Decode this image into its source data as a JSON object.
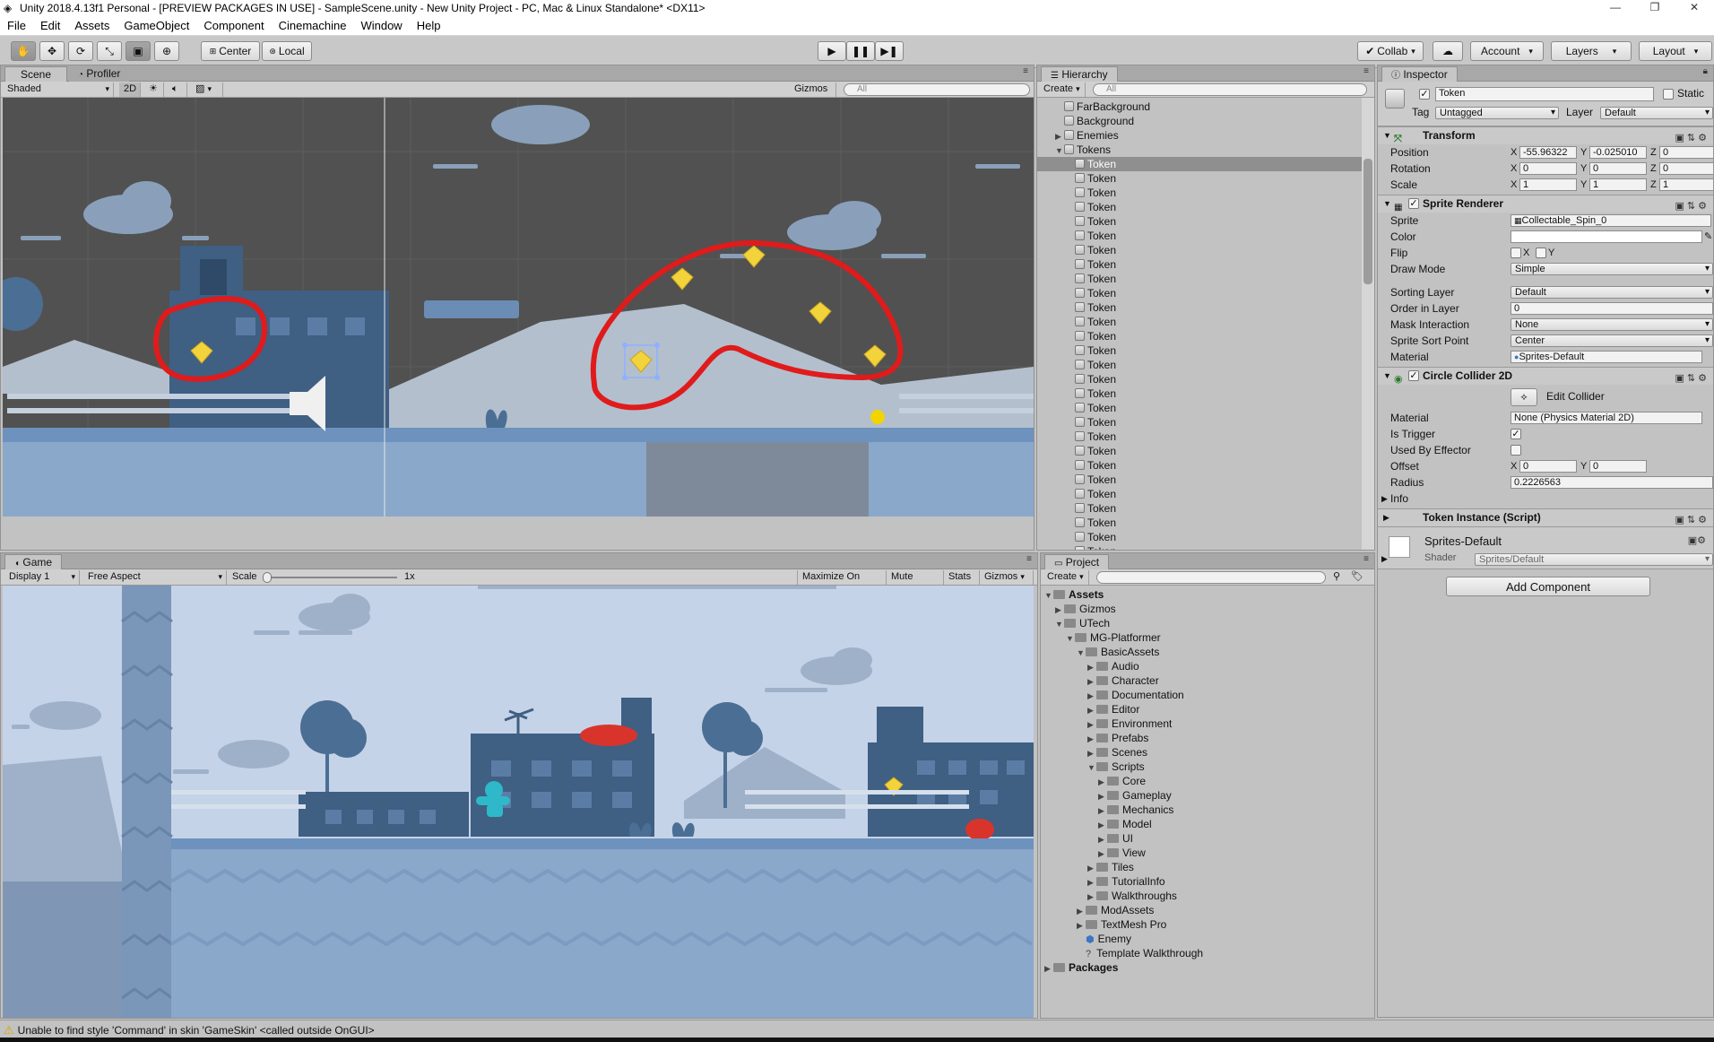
{
  "window": {
    "title": "Unity 2018.4.13f1 Personal - [PREVIEW PACKAGES IN USE] - SampleScene.unity - New Unity Project - PC, Mac & Linux Standalone* <DX11>",
    "minimize": "—",
    "maximize": "❐",
    "close": "✕"
  },
  "menu": [
    "File",
    "Edit",
    "Assets",
    "GameObject",
    "Component",
    "Cinemachine",
    "Window",
    "Help"
  ],
  "toolbar": {
    "pivot": "Center",
    "handle": "Local",
    "collab": "Collab",
    "account": "Account",
    "layers": "Layers",
    "layout": "Layout"
  },
  "scene_panel": {
    "tabs": [
      "Scene",
      "Profiler"
    ],
    "shading_mode": "Shaded",
    "mode_2d": "2D",
    "gizmos": "Gizmos",
    "search_placeholder": "All"
  },
  "game_panel": {
    "tab": "Game",
    "display": "Display 1",
    "aspect": "Free Aspect",
    "scale_label": "Scale",
    "scale_value": "1x",
    "maximize_on_play": "Maximize On Play",
    "mute_audio": "Mute Audio",
    "stats": "Stats",
    "gizmos": "Gizmos"
  },
  "hierarchy": {
    "tab": "Hierarchy",
    "create": "Create",
    "search_placeholder": "All",
    "items": [
      {
        "label": "FarBackground",
        "depth": 1,
        "fold": ""
      },
      {
        "label": "Background",
        "depth": 1,
        "fold": ""
      },
      {
        "label": "Enemies",
        "depth": 1,
        "fold": "▶"
      },
      {
        "label": "Tokens",
        "depth": 1,
        "fold": "▼"
      },
      {
        "label": "Token",
        "depth": 2,
        "fold": "",
        "selected": true
      },
      {
        "label": "Token",
        "depth": 2,
        "fold": ""
      },
      {
        "label": "Token",
        "depth": 2,
        "fold": ""
      },
      {
        "label": "Token",
        "depth": 2,
        "fold": ""
      },
      {
        "label": "Token",
        "depth": 2,
        "fold": ""
      },
      {
        "label": "Token",
        "depth": 2,
        "fold": ""
      },
      {
        "label": "Token",
        "depth": 2,
        "fold": ""
      },
      {
        "label": "Token",
        "depth": 2,
        "fold": ""
      },
      {
        "label": "Token",
        "depth": 2,
        "fold": ""
      },
      {
        "label": "Token",
        "depth": 2,
        "fold": ""
      },
      {
        "label": "Token",
        "depth": 2,
        "fold": ""
      },
      {
        "label": "Token",
        "depth": 2,
        "fold": ""
      },
      {
        "label": "Token",
        "depth": 2,
        "fold": ""
      },
      {
        "label": "Token",
        "depth": 2,
        "fold": ""
      },
      {
        "label": "Token",
        "depth": 2,
        "fold": ""
      },
      {
        "label": "Token",
        "depth": 2,
        "fold": ""
      },
      {
        "label": "Token",
        "depth": 2,
        "fold": ""
      },
      {
        "label": "Token",
        "depth": 2,
        "fold": ""
      },
      {
        "label": "Token",
        "depth": 2,
        "fold": ""
      },
      {
        "label": "Token",
        "depth": 2,
        "fold": ""
      },
      {
        "label": "Token",
        "depth": 2,
        "fold": ""
      },
      {
        "label": "Token",
        "depth": 2,
        "fold": ""
      },
      {
        "label": "Token",
        "depth": 2,
        "fold": ""
      },
      {
        "label": "Token",
        "depth": 2,
        "fold": ""
      },
      {
        "label": "Token",
        "depth": 2,
        "fold": ""
      },
      {
        "label": "Token",
        "depth": 2,
        "fold": ""
      },
      {
        "label": "Token",
        "depth": 2,
        "fold": ""
      },
      {
        "label": "Token",
        "depth": 2,
        "fold": ""
      }
    ]
  },
  "project": {
    "tab": "Project",
    "create": "Create",
    "items": [
      {
        "label": "Assets",
        "depth": 0,
        "fold": "▼",
        "kind": "folder",
        "bold": true
      },
      {
        "label": "Gizmos",
        "depth": 1,
        "fold": "▶",
        "kind": "folder"
      },
      {
        "label": "UTech",
        "depth": 1,
        "fold": "▼",
        "kind": "folder"
      },
      {
        "label": "MG-Platformer",
        "depth": 2,
        "fold": "▼",
        "kind": "folder"
      },
      {
        "label": "BasicAssets",
        "depth": 3,
        "fold": "▼",
        "kind": "folder"
      },
      {
        "label": "Audio",
        "depth": 4,
        "fold": "▶",
        "kind": "folder"
      },
      {
        "label": "Character",
        "depth": 4,
        "fold": "▶",
        "kind": "folder"
      },
      {
        "label": "Documentation",
        "depth": 4,
        "fold": "▶",
        "kind": "folder"
      },
      {
        "label": "Editor",
        "depth": 4,
        "fold": "▶",
        "kind": "folder"
      },
      {
        "label": "Environment",
        "depth": 4,
        "fold": "▶",
        "kind": "folder"
      },
      {
        "label": "Prefabs",
        "depth": 4,
        "fold": "▶",
        "kind": "folder"
      },
      {
        "label": "Scenes",
        "depth": 4,
        "fold": "▶",
        "kind": "folder"
      },
      {
        "label": "Scripts",
        "depth": 4,
        "fold": "▼",
        "kind": "folder"
      },
      {
        "label": "Core",
        "depth": 5,
        "fold": "▶",
        "kind": "folder"
      },
      {
        "label": "Gameplay",
        "depth": 5,
        "fold": "▶",
        "kind": "folder"
      },
      {
        "label": "Mechanics",
        "depth": 5,
        "fold": "▶",
        "kind": "folder"
      },
      {
        "label": "Model",
        "depth": 5,
        "fold": "▶",
        "kind": "folder"
      },
      {
        "label": "UI",
        "depth": 5,
        "fold": "▶",
        "kind": "folder"
      },
      {
        "label": "View",
        "depth": 5,
        "fold": "▶",
        "kind": "folder"
      },
      {
        "label": "Tiles",
        "depth": 4,
        "fold": "▶",
        "kind": "folder"
      },
      {
        "label": "TutorialInfo",
        "depth": 4,
        "fold": "▶",
        "kind": "folder"
      },
      {
        "label": "Walkthroughs",
        "depth": 4,
        "fold": "▶",
        "kind": "folder"
      },
      {
        "label": "ModAssets",
        "depth": 3,
        "fold": "▶",
        "kind": "folder"
      },
      {
        "label": "TextMesh Pro",
        "depth": 3,
        "fold": "▶",
        "kind": "folder"
      },
      {
        "label": "Enemy",
        "depth": 3,
        "fold": "",
        "kind": "prefab"
      },
      {
        "label": "Template Walkthrough",
        "depth": 3,
        "fold": "",
        "kind": "unknown"
      },
      {
        "label": "Packages",
        "depth": 0,
        "fold": "▶",
        "kind": "folder",
        "bold": true
      }
    ]
  },
  "inspector": {
    "tab": "Inspector",
    "object_name": "Token",
    "static_label": "Static",
    "tag_label": "Tag",
    "tag_value": "Untagged",
    "layer_label": "Layer",
    "layer_value": "Default",
    "transform": {
      "title": "Transform",
      "position_label": "Position",
      "position": [
        "-55.96322",
        "-0.025010",
        "0"
      ],
      "rotation_label": "Rotation",
      "rotation": [
        "0",
        "0",
        "0"
      ],
      "scale_label": "Scale",
      "scale": [
        "1",
        "1",
        "1"
      ]
    },
    "sprite_renderer": {
      "title": "Sprite Renderer",
      "sprite_label": "Sprite",
      "sprite_value": "Collectable_Spin_0",
      "color_label": "Color",
      "flip_label": "Flip",
      "draw_mode_label": "Draw Mode",
      "draw_mode": "Simple",
      "sorting_layer_label": "Sorting Layer",
      "sorting_layer": "Default",
      "order_label": "Order in Layer",
      "order": "0",
      "mask_label": "Mask Interaction",
      "mask": "None",
      "sort_point_label": "Sprite Sort Point",
      "sort_point": "Center",
      "material_label": "Material",
      "material": "Sprites-Default"
    },
    "circle_collider": {
      "title": "Circle Collider 2D",
      "edit_collider": "Edit Collider",
      "material_label": "Material",
      "material": "None (Physics Material 2D)",
      "is_trigger_label": "Is Trigger",
      "used_by_effector_label": "Used By Effector",
      "offset_label": "Offset",
      "offset": [
        "0",
        "0"
      ],
      "radius_label": "Radius",
      "radius": "0.2226563",
      "info_label": "Info"
    },
    "token_instance": {
      "title": "Token Instance (Script)"
    },
    "material_block": {
      "name": "Sprites-Default",
      "shader_label": "Shader",
      "shader": "Sprites/Default"
    },
    "add_component": "Add Component"
  },
  "console": {
    "message": "Unable to find style 'Command' in skin 'GameSkin' <called outside OnGUI>"
  },
  "colors": {
    "scene_bg": "#515151",
    "game_sky": "#c5d3e8",
    "building": "#3f5f83",
    "token": "#f2d33b",
    "annotation": "#e01b1b"
  }
}
